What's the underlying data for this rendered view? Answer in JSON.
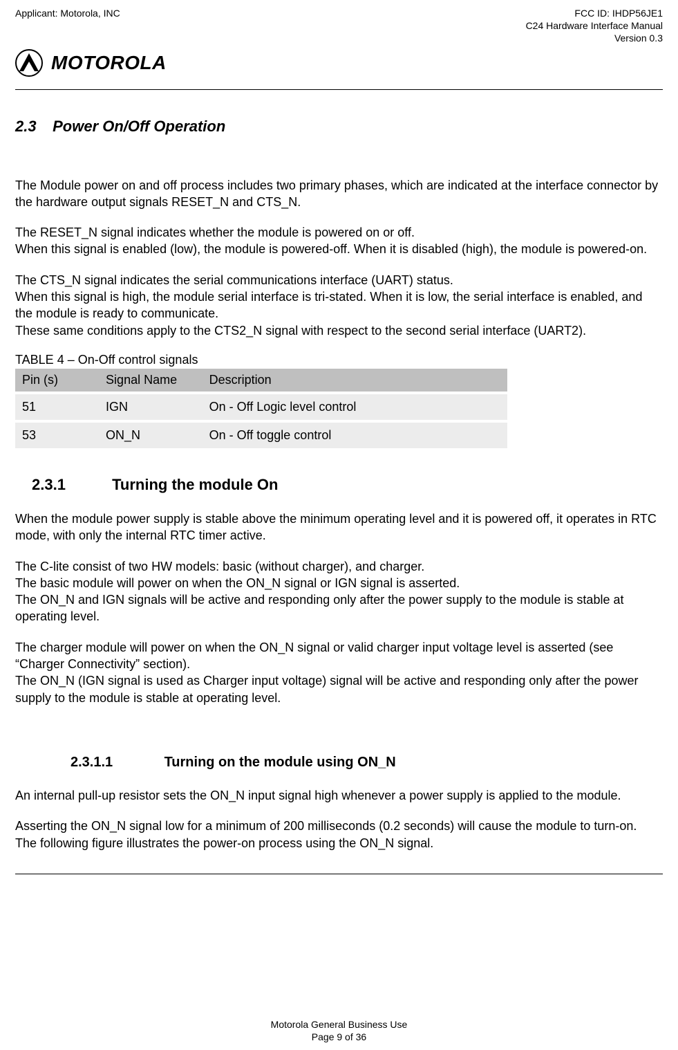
{
  "header": {
    "applicant": "Applicant: Motorola, INC",
    "fcc_id": "FCC ID: IHDP56JE1",
    "manual_title": "C24 Hardware Interface Manual",
    "version": "Version 0.3",
    "wordmark": "MOTOROLA"
  },
  "section": {
    "number": "2.3",
    "title": "Power On/Off Operation"
  },
  "intro": {
    "p1": "The Module power on and off process includes two primary phases, which are indicated at the interface connector by the hardware output signals RESET_N and CTS_N.",
    "p2a": "The RESET_N signal indicates whether the module is powered on or off.",
    "p2b": "When this signal is enabled (low), the module is powered-off. When it is disabled (high), the module is powered-on.",
    "p3a": "The CTS_N signal indicates the serial communications interface (UART) status.",
    "p3b": "When this signal is high, the module serial interface is tri-stated. When it is low, the serial interface is enabled, and the module is ready to communicate.",
    "p3c": "These same conditions apply to the CTS2_N signal with respect to the second serial interface (UART2)."
  },
  "table": {
    "caption": "TABLE 4 – On-Off control signals",
    "headers": {
      "h1": "Pin (s)",
      "h2": "Signal Name",
      "h3": "Description"
    },
    "rows": [
      {
        "pin": "51",
        "signal": "IGN",
        "desc": "On - Off Logic level control"
      },
      {
        "pin": "53",
        "signal": "ON_N",
        "desc": "On - Off toggle control"
      }
    ]
  },
  "sub231": {
    "number": "2.3.1",
    "title": "Turning the module On",
    "p1": "When the module power supply is stable above the minimum operating level and it is powered off, it operates in RTC mode, with only the internal RTC timer active.",
    "p2a": "The C-lite consist of two HW models: basic (without charger), and charger.",
    "p2b": "The basic module will power on when the ON_N signal or IGN signal is asserted.",
    "p2c": "The ON_N and IGN signals will be active and responding only after the power supply to the module is stable at operating level.",
    "p3a": "The charger module will power on when the ON_N signal or valid charger input voltage level is asserted (see “Charger Connectivity” section).",
    "p3b": "The ON_N (IGN signal is used as Charger input voltage) signal will be active and responding only after the power supply to the module is stable at operating level."
  },
  "sub2311": {
    "number": "2.3.1.1",
    "title": "Turning on the module using ON_N",
    "p1": "An internal pull-up resistor sets the ON_N input signal high whenever a power supply is applied to the module.",
    "p2a": "Asserting the ON_N signal low for a minimum of 200 milliseconds (0.2 seconds) will cause the module to turn-on.",
    "p2b": "The following figure illustrates the power-on process using the ON_N signal."
  },
  "footer": {
    "line1": "Motorola General Business Use",
    "line2": "Page 9 of 36"
  }
}
